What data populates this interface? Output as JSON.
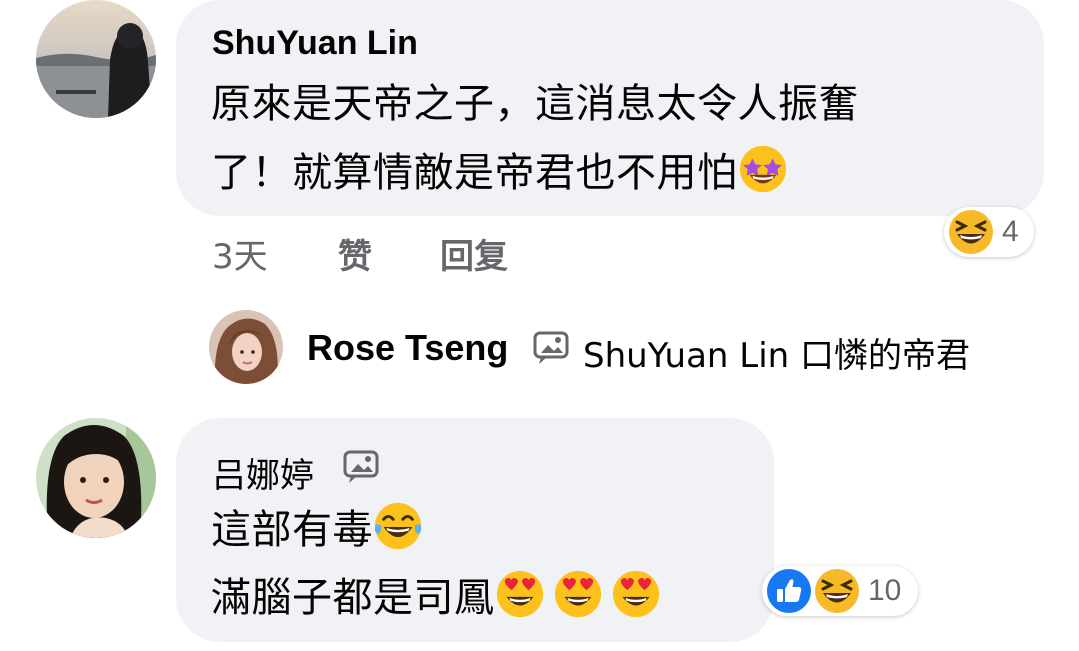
{
  "comments": [
    {
      "author": "ShuYuan Lin",
      "line1": "原來是天帝之子，這消息太令人振奮",
      "line2": "了！就算情敵是帝君也不用怕",
      "time": "3天",
      "like_label": "赞",
      "reply_label": "回复",
      "reaction_count": "4",
      "reaction_icons": [
        "laugh-emoji"
      ]
    },
    {
      "author": "吕娜婷",
      "line1": "這部有毒",
      "line2": "滿腦子都是司鳳",
      "reaction_count": "10",
      "reaction_icons": [
        "like-icon",
        "laugh-emoji"
      ]
    }
  ],
  "reply_preview": {
    "author": "Rose Tseng",
    "text": "ShuYuan Lin 口憐的帝君"
  }
}
